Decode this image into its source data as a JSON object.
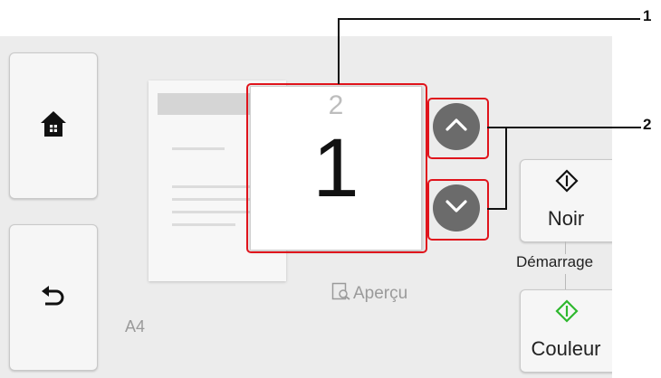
{
  "callouts": {
    "one": "1",
    "two": "2"
  },
  "copies": {
    "value": "1",
    "previous_value": "2"
  },
  "paper": {
    "size": "A4"
  },
  "preview": {
    "label": "Aperçu"
  },
  "start": {
    "label": "Démarrage",
    "black_label": "Noir",
    "color_label": "Couleur"
  },
  "icons": {
    "home": "home-icon",
    "back": "back-arrow-icon",
    "up": "chevron-up-icon",
    "down": "chevron-down-icon",
    "preview": "preview-icon",
    "start": "start-diamond-icon"
  },
  "colors": {
    "highlight": "#e0141c",
    "start_black": "#111111",
    "start_color": "#2eb82e",
    "round_button": "#6b6b6b"
  }
}
